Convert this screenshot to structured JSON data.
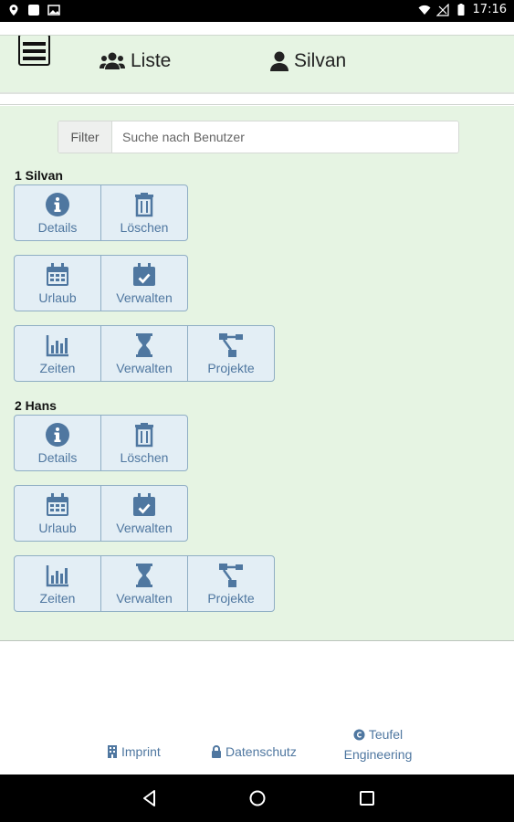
{
  "status_bar": {
    "time": "17:16",
    "left_icons": [
      "location-icon",
      "notification-icon",
      "image-icon"
    ],
    "right_icons": [
      "wifi-icon",
      "signal-off-icon",
      "battery-icon"
    ]
  },
  "header": {
    "nav": {
      "list_label": "Liste",
      "user_label": "Silvan"
    }
  },
  "filter": {
    "label": "Filter",
    "placeholder": "Suche nach Benutzer",
    "value": ""
  },
  "users": [
    {
      "heading": "1  Silvan",
      "groups": [
        [
          {
            "label": "Details",
            "icon": "info-icon"
          },
          {
            "label": "Löschen",
            "icon": "trash-icon"
          }
        ],
        [
          {
            "label": "Urlaub",
            "icon": "calendar-icon"
          },
          {
            "label": "Verwalten",
            "icon": "calendar-check-icon"
          }
        ],
        [
          {
            "label": "Zeiten",
            "icon": "bar-chart-icon"
          },
          {
            "label": "Verwalten",
            "icon": "hourglass-icon"
          },
          {
            "label": "Projekte",
            "icon": "project-tree-icon"
          }
        ]
      ]
    },
    {
      "heading": "2  Hans",
      "groups": [
        [
          {
            "label": "Details",
            "icon": "info-icon"
          },
          {
            "label": "Löschen",
            "icon": "trash-icon"
          }
        ],
        [
          {
            "label": "Urlaub",
            "icon": "calendar-icon"
          },
          {
            "label": "Verwalten",
            "icon": "calendar-check-icon"
          }
        ],
        [
          {
            "label": "Zeiten",
            "icon": "bar-chart-icon"
          },
          {
            "label": "Verwalten",
            "icon": "hourglass-icon"
          },
          {
            "label": "Projekte",
            "icon": "project-tree-icon"
          }
        ]
      ]
    }
  ],
  "footer": {
    "imprint": "Imprint",
    "privacy": "Datenschutz",
    "company_line1": "Teufel",
    "company_line2": "Engineering"
  },
  "colors": {
    "accent": "#4f77a0",
    "button_bg": "#e3eef5",
    "panel_bg": "#e6f4e3"
  }
}
